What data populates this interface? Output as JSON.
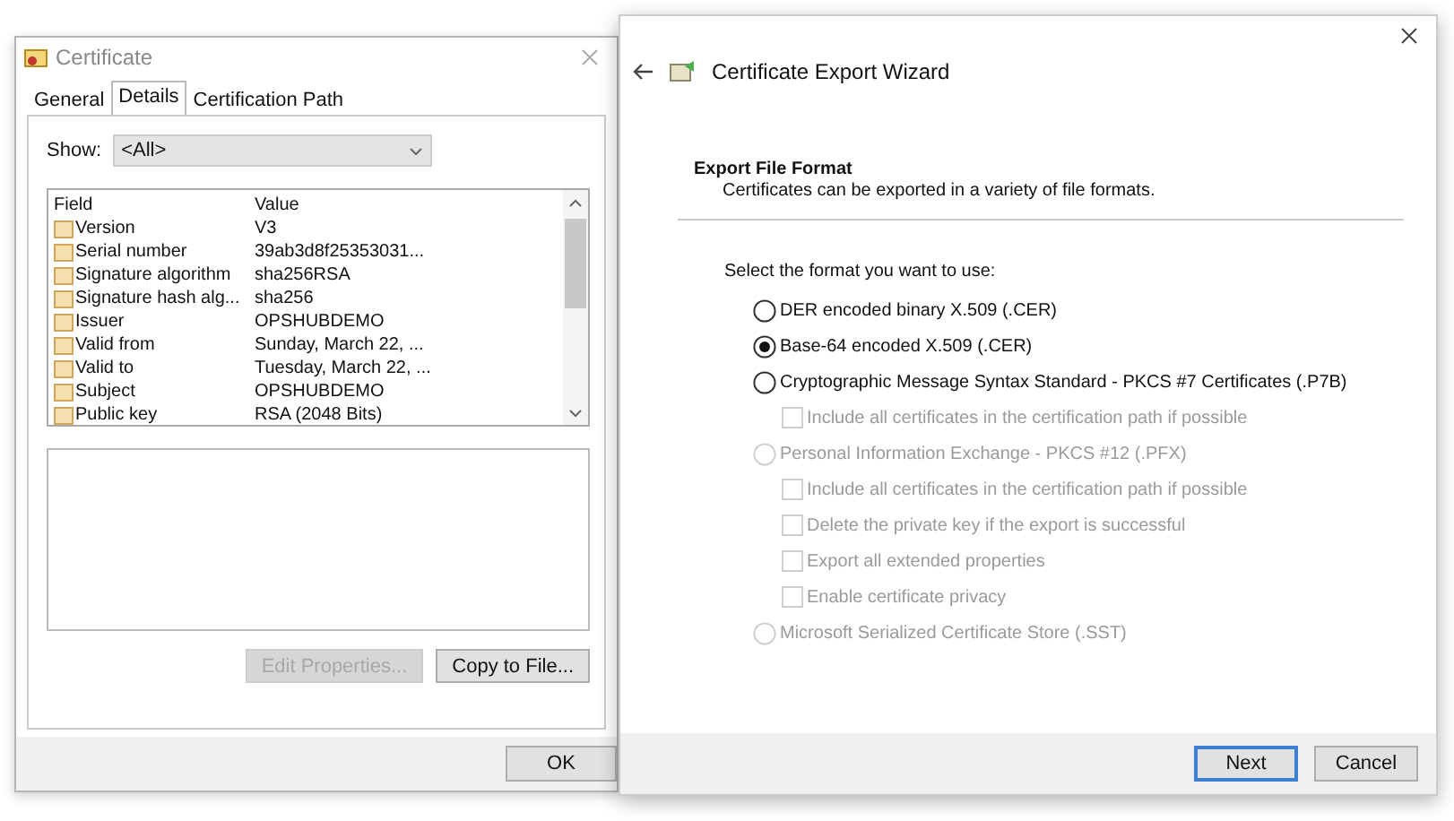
{
  "certificate": {
    "title": "Certificate",
    "tabs": [
      {
        "label": "General",
        "selected": false
      },
      {
        "label": "Details",
        "selected": true
      },
      {
        "label": "Certification Path",
        "selected": false
      }
    ],
    "show": {
      "label": "Show:",
      "value": "<All>"
    },
    "columns": [
      "Field",
      "Value"
    ],
    "rows": [
      {
        "field": "Version",
        "value": "V3"
      },
      {
        "field": "Serial number",
        "value": "39ab3d8f25353031..."
      },
      {
        "field": "Signature algorithm",
        "value": "sha256RSA"
      },
      {
        "field": "Signature hash alg...",
        "value": "sha256"
      },
      {
        "field": "Issuer",
        "value": "OPSHUBDEMO"
      },
      {
        "field": "Valid from",
        "value": "Sunday, March 22, ..."
      },
      {
        "field": "Valid to",
        "value": "Tuesday, March 22, ..."
      },
      {
        "field": "Subject",
        "value": "OPSHUBDEMO"
      },
      {
        "field": "Public key",
        "value": "RSA (2048 Bits)"
      }
    ],
    "buttons": [
      {
        "label": "Edit Properties...",
        "disabled": true
      },
      {
        "label": "Copy to File...",
        "disabled": false
      }
    ],
    "ok_button": "OK"
  },
  "wizard": {
    "title": "Certificate Export Wizard",
    "section_title": "Export File Format",
    "section_description": "Certificates can be exported in a variety of file formats.",
    "prompt": "Select the format you want to use:",
    "options": [
      {
        "label": "DER encoded binary X.509 (.CER)",
        "selected": false,
        "disabled": false
      },
      {
        "label": "Base-64 encoded X.509 (.CER)",
        "selected": true,
        "disabled": false
      },
      {
        "label": "Cryptographic Message Syntax Standard - PKCS #7 Certificates (.P7B)",
        "selected": false,
        "disabled": false,
        "children": [
          {
            "label": "Include all certificates in the certification path if possible",
            "checked": false,
            "disabled": true
          }
        ]
      },
      {
        "label": "Personal Information Exchange - PKCS #12 (.PFX)",
        "selected": false,
        "disabled": true,
        "children": [
          {
            "label": "Include all certificates in the certification path if possible",
            "checked": false,
            "disabled": true
          },
          {
            "label": "Delete the private key if the export is successful",
            "checked": false,
            "disabled": true
          },
          {
            "label": "Export all extended properties",
            "checked": false,
            "disabled": true
          },
          {
            "label": "Enable certificate privacy",
            "checked": false,
            "disabled": true
          }
        ]
      },
      {
        "label": "Microsoft Serialized Certificate Store (.SST)",
        "selected": false,
        "disabled": true
      }
    ],
    "buttons": [
      {
        "label": "Next",
        "default": true
      },
      {
        "label": "Cancel",
        "default": false
      }
    ]
  }
}
